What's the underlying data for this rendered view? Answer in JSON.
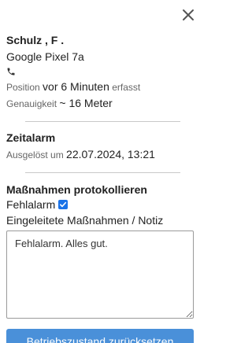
{
  "close_icon": "close-icon",
  "person": {
    "name": "Schulz , F .",
    "device": "Google Pixel 7a",
    "phone_icon": "phone-icon",
    "position_label": "Position",
    "position_value": "vor 6 Minuten",
    "position_suffix": "erfasst",
    "accuracy_label": "Genauigkeit",
    "accuracy_value": "~ 16 Meter"
  },
  "alarm": {
    "title": "Zeitalarm",
    "triggered_label": "Ausgelöst um",
    "triggered_value": "22.07.2024, 13:21"
  },
  "actions": {
    "title": "Maßnahmen protokollieren",
    "false_alarm_label": "Fehlalarm",
    "false_alarm_checked": true,
    "note_label": "Eingeleitete Maßnahmen / Notiz",
    "note_value": "Fehlalarm. Alles gut."
  },
  "reset_button_label": "Betriebszustand zurücksetzen",
  "colors": {
    "accent": "#1a73e8",
    "button_bg": "#4a90d9",
    "divider": "#c8c8c8"
  }
}
